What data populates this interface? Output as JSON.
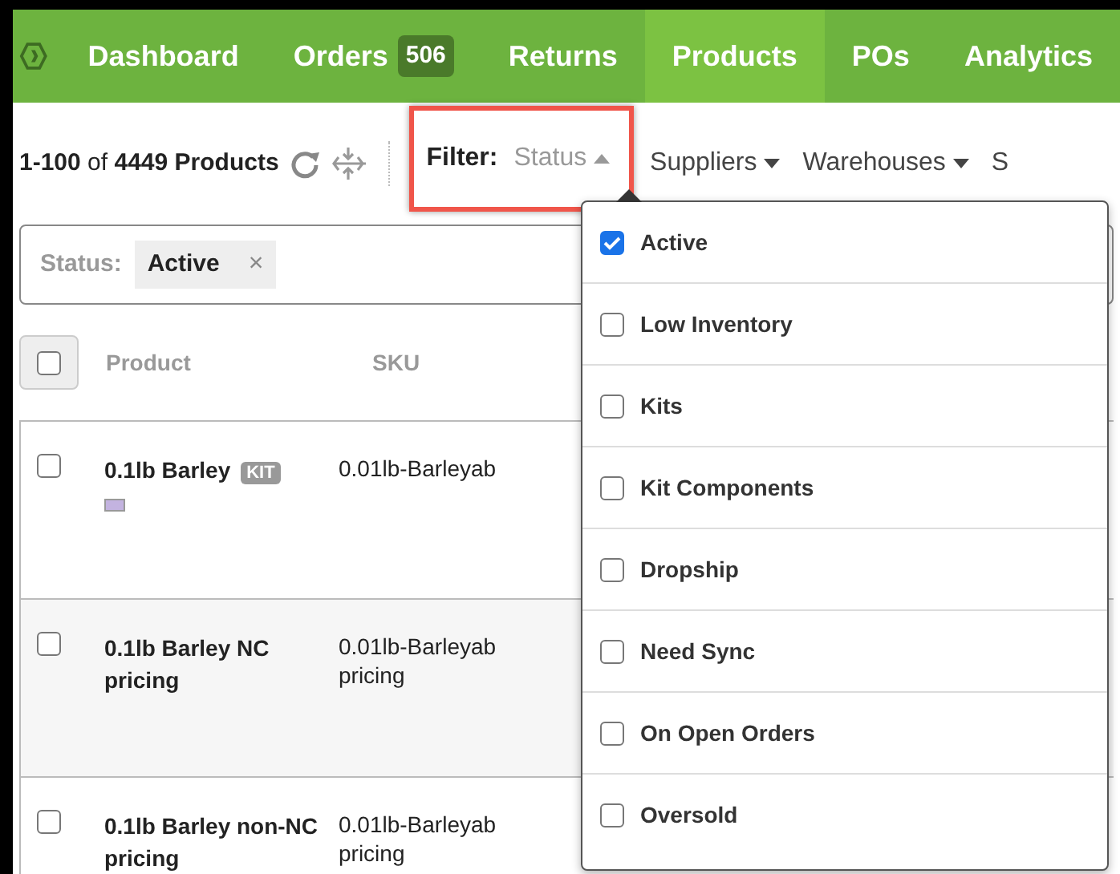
{
  "nav": {
    "items": [
      {
        "label": "Dashboard",
        "selected": false
      },
      {
        "label": "Orders",
        "badge": "506",
        "selected": false
      },
      {
        "label": "Returns",
        "selected": false
      },
      {
        "label": "Products",
        "selected": true
      },
      {
        "label": "POs",
        "selected": false
      },
      {
        "label": "Analytics",
        "selected": false
      }
    ]
  },
  "toolbar": {
    "count": "**1-100** of **4449 Products**",
    "filter_label": "Filter:",
    "filters": [
      {
        "label": "Status",
        "open": true
      },
      {
        "label": "Suppliers",
        "open": false
      },
      {
        "label": "Warehouses",
        "open": false
      },
      {
        "label": "S",
        "open": false
      }
    ]
  },
  "active_filters": {
    "label": "Status:",
    "chips": [
      {
        "label": "Active",
        "remove": "×"
      }
    ]
  },
  "table": {
    "select_all": false,
    "columns": [
      "Product",
      "SKU"
    ],
    "rows": [
      {
        "product": "0.1lb Barley",
        "tag": "KIT",
        "color": "#c3b3e0",
        "sku": [
          "0.01lb-Barleyab"
        ],
        "checked": false
      },
      {
        "product": "0.1lb Barley NC pricing",
        "sku": [
          "0.01lb-Barleyab",
          "pricing"
        ],
        "checked": false
      },
      {
        "product": "0.1lb Barley non-NC pricing",
        "sku": [
          "0.01lb-Barleyab",
          "pricing"
        ],
        "checked": false
      }
    ]
  },
  "status_menu": {
    "options": [
      {
        "label": "Active",
        "checked": true
      },
      {
        "label": "Low Inventory",
        "checked": false
      },
      {
        "label": "Kits",
        "checked": false
      },
      {
        "label": "Kit Components",
        "checked": false
      },
      {
        "label": "Dropship",
        "checked": false
      },
      {
        "label": "Need Sync",
        "checked": false
      },
      {
        "label": "On Open Orders",
        "checked": false
      },
      {
        "label": "Oversold",
        "checked": false
      }
    ]
  }
}
